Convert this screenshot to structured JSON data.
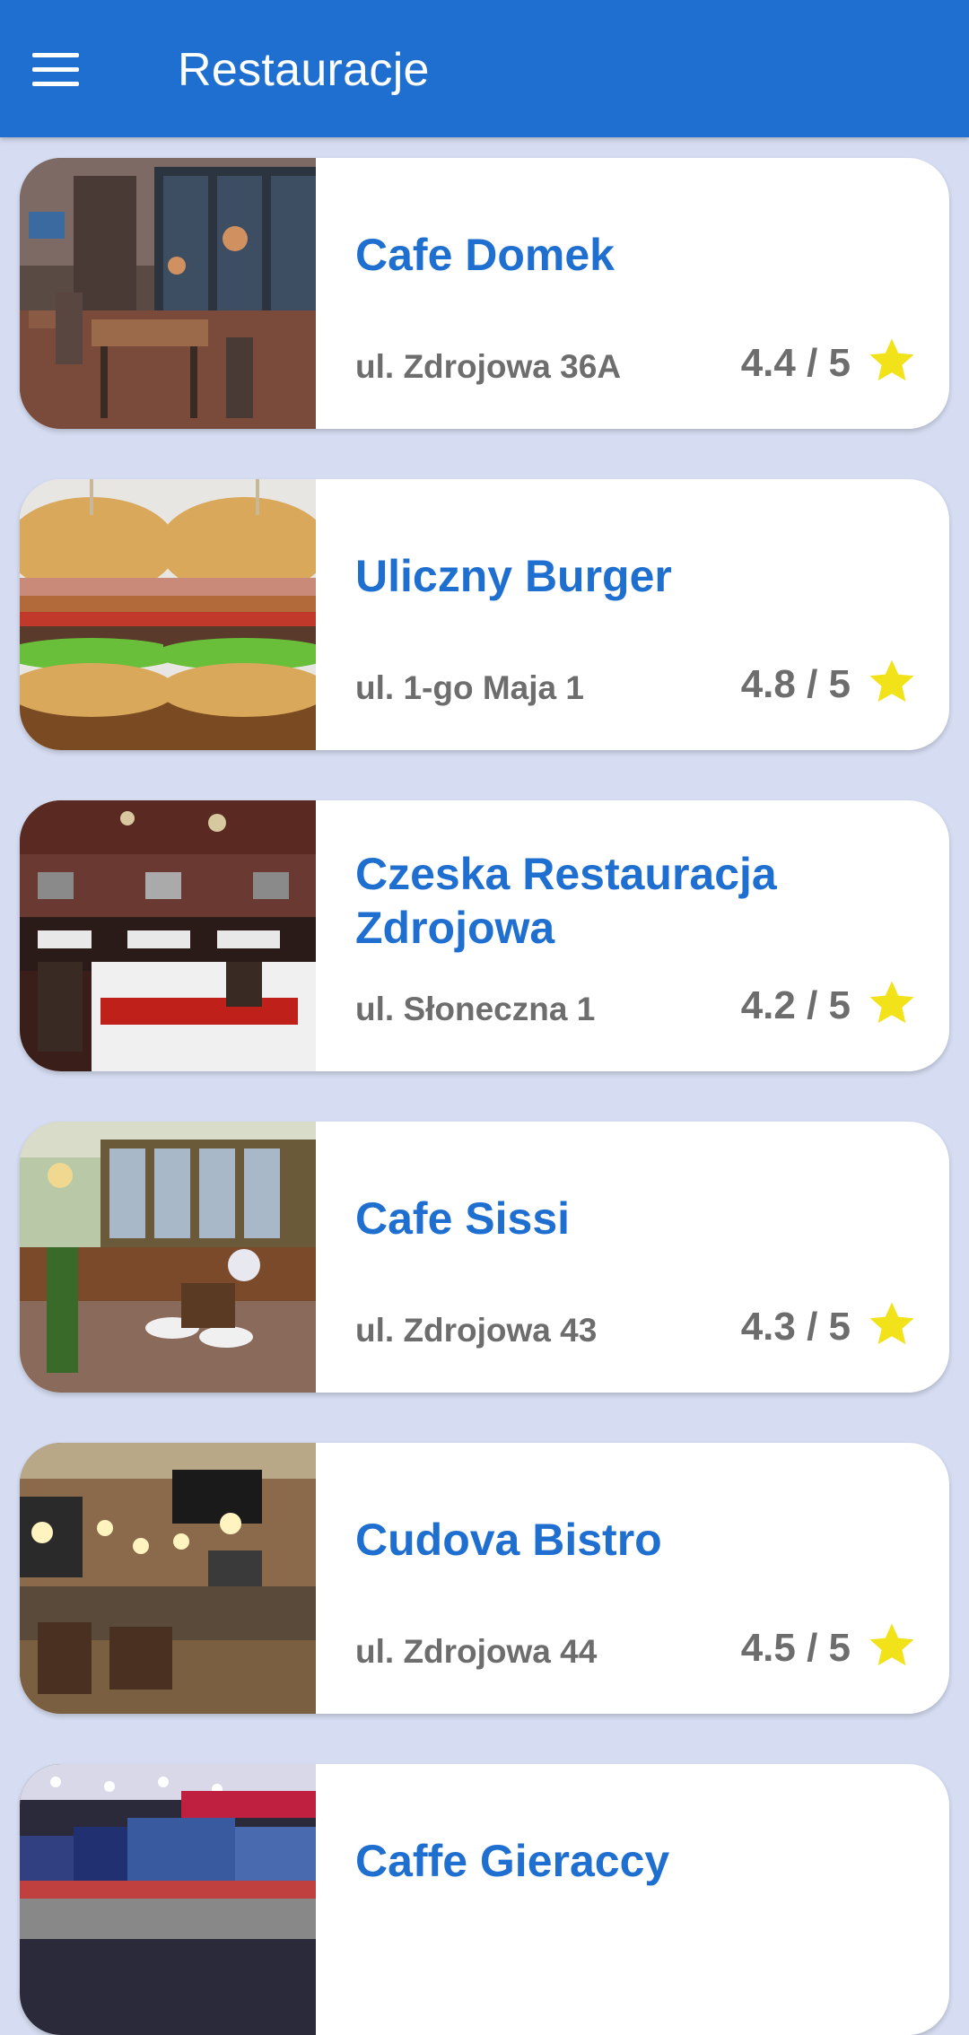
{
  "appbar": {
    "title": "Restauracje",
    "menu_icon": "menu-icon"
  },
  "restaurants": [
    {
      "name": "Cafe Domek",
      "address": "ul. Zdrojowa 36A",
      "rating": "4.4 / 5",
      "image": "cafe-interior-photo"
    },
    {
      "name": "Uliczny Burger",
      "address": "ul. 1-go Maja 1",
      "rating": "4.8 / 5",
      "image": "burgers-photo"
    },
    {
      "name": "Czeska Restauracja Zdrojowa",
      "address": "ul. Słoneczna 1",
      "rating": "4.2 / 5",
      "image": "restaurant-hall-photo"
    },
    {
      "name": "Cafe Sissi",
      "address": "ul. Zdrojowa 43",
      "rating": "4.3 / 5",
      "image": "cafe-bar-photo"
    },
    {
      "name": "Cudova Bistro",
      "address": "ul. Zdrojowa 44",
      "rating": "4.5 / 5",
      "image": "bistro-interior-photo"
    },
    {
      "name": "Caffe Gieraccy",
      "address": "",
      "rating": "",
      "image": "cafe-counter-photo"
    }
  ],
  "colors": {
    "primary": "#1f6fd1",
    "background": "#d6ddf2",
    "star": "#f2e21a",
    "secondary_text": "#6d6d6d"
  }
}
